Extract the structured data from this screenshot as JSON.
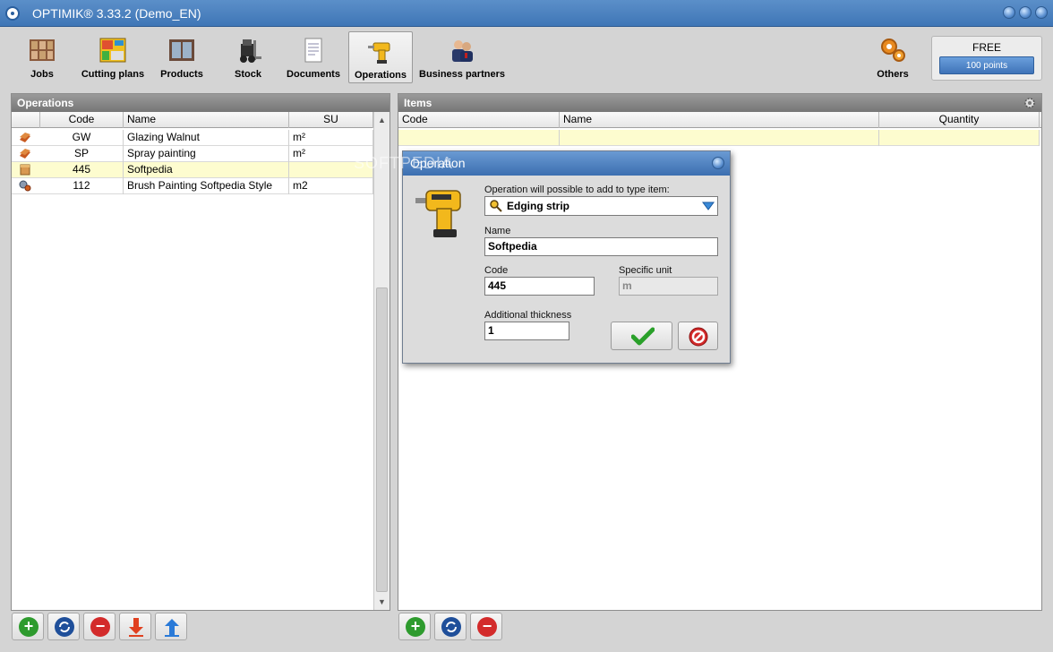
{
  "window": {
    "title": "OPTIMIK® 3.33.2  (Demo_EN)"
  },
  "toolbar": {
    "items": [
      {
        "label": "Jobs",
        "icon": "jobs-icon"
      },
      {
        "label": "Cutting plans",
        "icon": "cutting-plans-icon"
      },
      {
        "label": "Products",
        "icon": "products-icon"
      },
      {
        "label": "Stock",
        "icon": "forklift-icon"
      },
      {
        "label": "Documents",
        "icon": "documents-icon"
      },
      {
        "label": "Operations",
        "icon": "drill-icon"
      },
      {
        "label": "Business partners",
        "icon": "business-partners-icon"
      }
    ],
    "others_label": "Others",
    "license": {
      "plan": "FREE",
      "points": "100 points"
    }
  },
  "operations_panel": {
    "title": "Operations",
    "columns": [
      "Code",
      "Name",
      "SU"
    ],
    "rows": [
      {
        "code": "GW",
        "name": "Glazing Walnut",
        "su": "m²",
        "icon": "board-icon"
      },
      {
        "code": "SP",
        "name": "Spray painting",
        "su": "m²",
        "icon": "board-icon"
      },
      {
        "code": "445",
        "name": "Softpedia",
        "su": "",
        "icon": "edging-icon",
        "selected": true
      },
      {
        "code": "112",
        "name": "Brush Painting Softpedia Style",
        "su": "m2",
        "icon": "gears-icon"
      }
    ]
  },
  "items_panel": {
    "title": "Items",
    "columns": [
      "Code",
      "Name",
      "Quantity"
    ]
  },
  "dialog": {
    "title": "Operation",
    "type_label": "Operation will possible to add to type item:",
    "type_value": "Edging strip",
    "name_label": "Name",
    "name_value": "Softpedia",
    "code_label": "Code",
    "code_value": "445",
    "unit_label": "Specific unit",
    "unit_value": "m",
    "thickness_label": "Additional thickness",
    "thickness_value": "1"
  },
  "watermark": "SOFTPEDIA",
  "colors": {
    "title_bar": "#4a80c0",
    "panel_header": "#888888",
    "selected_row": "#fdfccf",
    "add": "#2e9b2e",
    "remove": "#d32b2b"
  }
}
